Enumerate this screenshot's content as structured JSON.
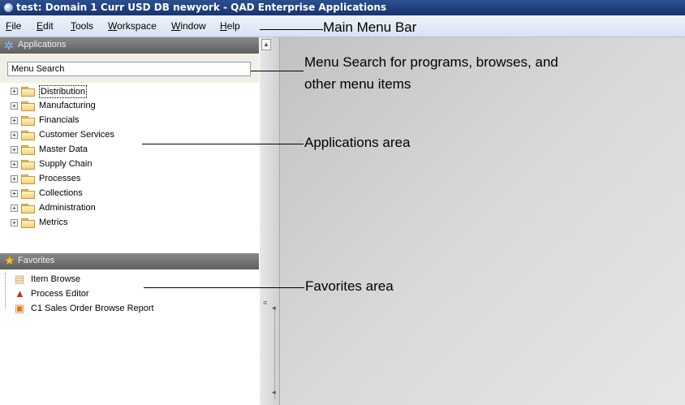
{
  "window": {
    "title": "test: Domain 1 Curr USD DB newyork - QAD Enterprise Applications"
  },
  "menu": [
    {
      "label": "File"
    },
    {
      "label": "Edit"
    },
    {
      "label": "Tools"
    },
    {
      "label": "Workspace"
    },
    {
      "label": "Window"
    },
    {
      "label": "Help"
    }
  ],
  "applications": {
    "header": "Applications",
    "search_value": "Menu Search",
    "items": [
      "Distribution",
      "Manufacturing",
      "Financials",
      "Customer Services",
      "Master Data",
      "Supply Chain",
      "Processes",
      "Collections",
      "Administration",
      "Metrics"
    ]
  },
  "favorites": {
    "header": "Favorites",
    "items": [
      "Item Browse",
      "Process Editor",
      "C1 Sales Order Browse Report"
    ]
  },
  "annotations": {
    "menu_bar": "Main Menu Bar",
    "menu_search_line1": "Menu Search for programs, browses, and",
    "menu_search_line2": "other menu items",
    "applications_area": "Applications area",
    "favorites_area": "Favorites area"
  },
  "icons": {
    "applications": "gear-icon",
    "favorites": "star-icon",
    "folder": "folder-icon",
    "expand": "plus-box-icon"
  }
}
